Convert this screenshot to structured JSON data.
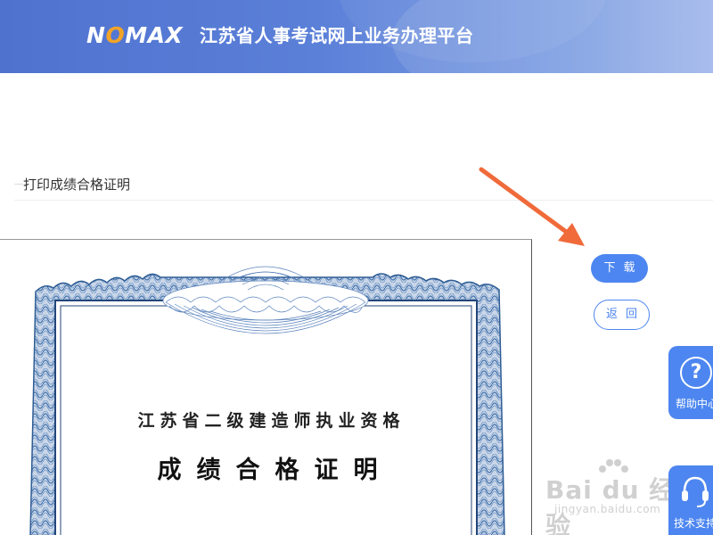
{
  "header": {
    "logo_prefix": "N",
    "logo_o": "O",
    "logo_suffix": "MAX",
    "platform_title": "江苏省人事考试网上业务办理平台",
    "accent_color": "#4f72cf",
    "logo_accent_color": "#f3a428"
  },
  "section": {
    "title": "打印成绩合格证明"
  },
  "certificate": {
    "line1": "江苏省二级建造师执业资格",
    "line2": "成绩合格证明"
  },
  "actions": {
    "download_label": "下载",
    "back_label": "返回",
    "button_color": "#4d86f0"
  },
  "side_widgets": {
    "help": {
      "icon": "question-circle-icon",
      "label": "帮助中心"
    },
    "support": {
      "icon": "headset-icon",
      "label": "技术支持"
    }
  },
  "annotation": {
    "arrow_color": "#f06a3a",
    "points_to": "download-button"
  },
  "watermark": {
    "main": "Bai du 经验",
    "sub": "jingyan.baidu.com"
  }
}
